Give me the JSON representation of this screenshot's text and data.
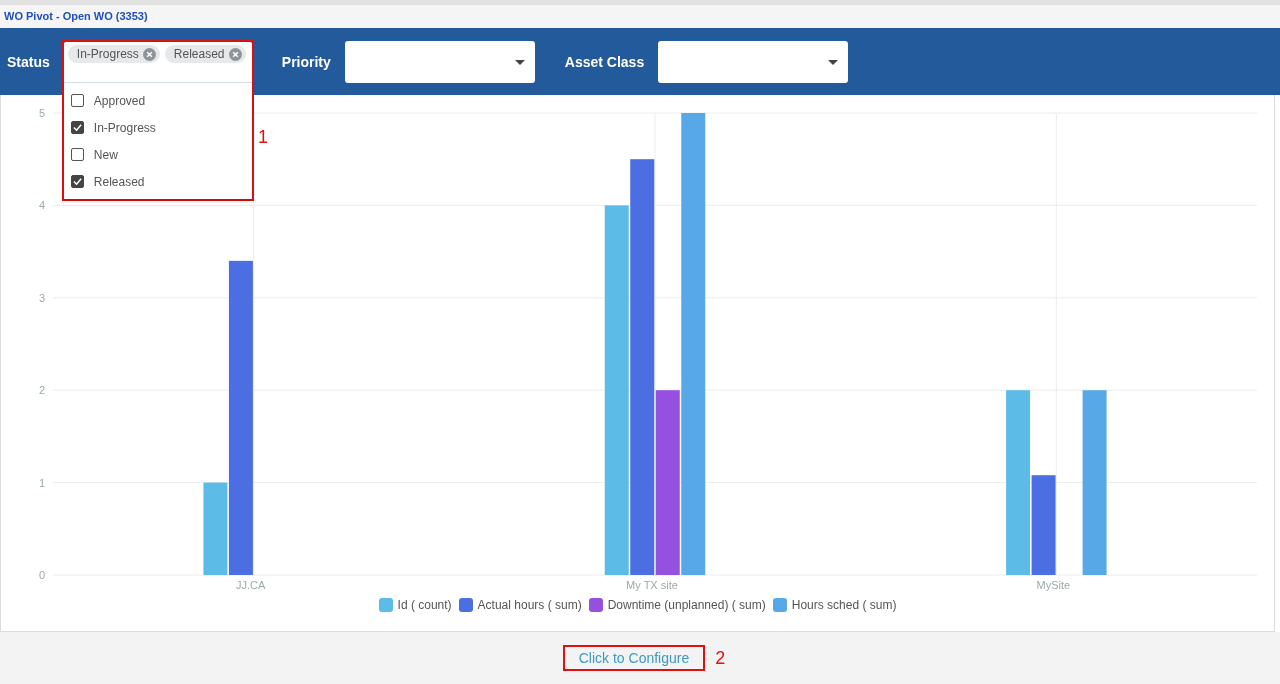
{
  "title": "WO Pivot - Open WO (3353)",
  "filters": [
    {
      "label": "Status",
      "kind": "multiselect",
      "expanded": true,
      "chips": [
        "In-Progress",
        "Released"
      ],
      "options": [
        {
          "label": "Approved",
          "checked": false
        },
        {
          "label": "In-Progress",
          "checked": true
        },
        {
          "label": "New",
          "checked": false
        },
        {
          "label": "Released",
          "checked": true
        }
      ]
    },
    {
      "label": "Priority",
      "kind": "select"
    },
    {
      "label": "Asset Class",
      "kind": "select"
    }
  ],
  "chart": {
    "chart_data": {
      "type": "bar",
      "grid": true,
      "legend": "bottom",
      "categories": [
        "JJ.CA",
        "My TX site",
        "MySite"
      ],
      "ylim": [
        0,
        5
      ],
      "yticks": [
        {
          "value": 0,
          "label": "0"
        },
        {
          "value": 1,
          "label": "1"
        },
        {
          "value": 2,
          "label": "2"
        },
        {
          "value": 3,
          "label": "3"
        },
        {
          "value": 4,
          "label": "4"
        },
        {
          "value": 5,
          "label": "5"
        }
      ],
      "series": [
        {
          "name": "Id ( count)",
          "color": "#5dbbe8",
          "values": [
            1,
            4,
            2
          ]
        },
        {
          "name": "Actual hours ( sum)",
          "color": "#4b6fe2",
          "values": [
            3.4,
            4.5,
            1.08
          ]
        },
        {
          "name": "Downtime (unplanned) ( sum)",
          "color": "#9650e0",
          "values": [
            null,
            2,
            null
          ]
        },
        {
          "name": "Hours sched ( sum)",
          "color": "#56a9e6",
          "values": [
            null,
            5,
            2
          ]
        }
      ]
    }
  },
  "configure_link": "Click to Configure",
  "callouts": [
    "1",
    "2"
  ]
}
